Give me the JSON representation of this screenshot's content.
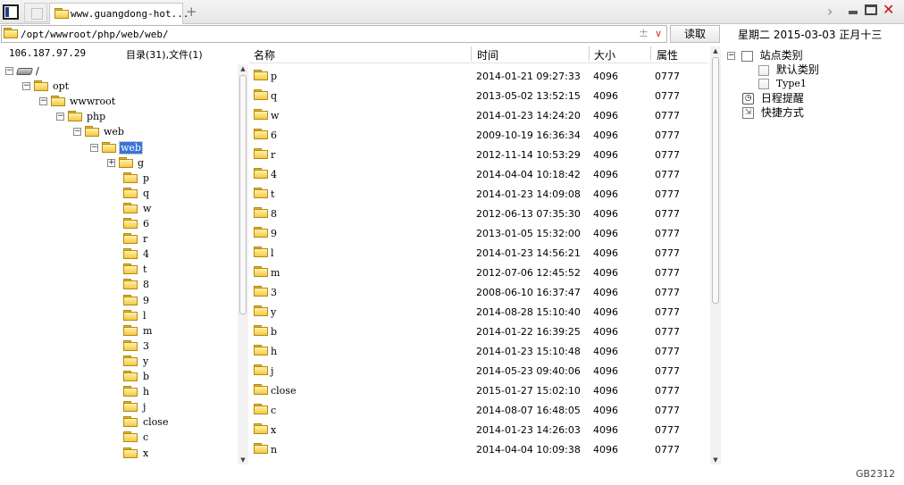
{
  "tabs": {
    "active_title": "www.guangdong-hot...",
    "new_tab_icon": "+"
  },
  "address": {
    "path": "/opt/wwwroot/php/web/web/",
    "plus_glyph": "±",
    "read_button": "读取"
  },
  "date_bar": "星期二  2015-03-03  正月十三",
  "info": {
    "ip": "106.187.97.29",
    "counts": "目录(31),文件(1)"
  },
  "tree": {
    "nodes": [
      {
        "label": "/",
        "icon": "drive-icon",
        "expander": "⊟"
      },
      {
        "label": "opt",
        "icon": "folder-icon",
        "expander": "⊟"
      },
      {
        "label": "wwwroot",
        "icon": "folder-icon",
        "expander": "⊟"
      },
      {
        "label": "php",
        "icon": "folder-icon",
        "expander": "⊟"
      },
      {
        "label": "web",
        "icon": "folder-icon",
        "expander": "⊟"
      },
      {
        "label": "web",
        "icon": "folder-icon",
        "expander": "⊟",
        "selected": true
      },
      {
        "label": "g",
        "icon": "folder-icon",
        "expander": "⊞"
      },
      {
        "label": "p",
        "icon": "folder-icon"
      },
      {
        "label": "q",
        "icon": "folder-icon"
      },
      {
        "label": "w",
        "icon": "folder-icon"
      },
      {
        "label": "6",
        "icon": "folder-icon"
      },
      {
        "label": "r",
        "icon": "folder-icon"
      },
      {
        "label": "4",
        "icon": "folder-icon"
      },
      {
        "label": "t",
        "icon": "folder-icon"
      },
      {
        "label": "8",
        "icon": "folder-icon"
      },
      {
        "label": "9",
        "icon": "folder-icon"
      },
      {
        "label": "l",
        "icon": "folder-icon"
      },
      {
        "label": "m",
        "icon": "folder-icon"
      },
      {
        "label": "3",
        "icon": "folder-icon"
      },
      {
        "label": "y",
        "icon": "folder-icon"
      },
      {
        "label": "b",
        "icon": "folder-icon"
      },
      {
        "label": "h",
        "icon": "folder-icon"
      },
      {
        "label": "j",
        "icon": "folder-icon"
      },
      {
        "label": "close",
        "icon": "folder-icon"
      },
      {
        "label": "c",
        "icon": "folder-icon"
      },
      {
        "label": "x",
        "icon": "folder-icon"
      }
    ]
  },
  "file_list": {
    "columns": [
      "名称",
      "时间",
      "大小",
      "属性"
    ],
    "rows": [
      {
        "name": "p",
        "time": "2014-01-21 09:27:33",
        "size": "4096",
        "attr": "0777"
      },
      {
        "name": "q",
        "time": "2013-05-02 13:52:15",
        "size": "4096",
        "attr": "0777"
      },
      {
        "name": "w",
        "time": "2014-01-23 14:24:20",
        "size": "4096",
        "attr": "0777"
      },
      {
        "name": "6",
        "time": "2009-10-19 16:36:34",
        "size": "4096",
        "attr": "0777"
      },
      {
        "name": "r",
        "time": "2012-11-14 10:53:29",
        "size": "4096",
        "attr": "0777"
      },
      {
        "name": "4",
        "time": "2014-04-04 10:18:42",
        "size": "4096",
        "attr": "0777"
      },
      {
        "name": "t",
        "time": "2014-01-23 14:09:08",
        "size": "4096",
        "attr": "0777"
      },
      {
        "name": "8",
        "time": "2012-06-13 07:35:30",
        "size": "4096",
        "attr": "0777"
      },
      {
        "name": "9",
        "time": "2013-01-05 15:32:00",
        "size": "4096",
        "attr": "0777"
      },
      {
        "name": "l",
        "time": "2014-01-23 14:56:21",
        "size": "4096",
        "attr": "0777"
      },
      {
        "name": "m",
        "time": "2012-07-06 12:45:52",
        "size": "4096",
        "attr": "0777"
      },
      {
        "name": "3",
        "time": "2008-06-10 16:37:47",
        "size": "4096",
        "attr": "0777"
      },
      {
        "name": "y",
        "time": "2014-08-28 15:10:40",
        "size": "4096",
        "attr": "0777"
      },
      {
        "name": "b",
        "time": "2014-01-22 16:39:25",
        "size": "4096",
        "attr": "0777"
      },
      {
        "name": "h",
        "time": "2014-01-23 15:10:48",
        "size": "4096",
        "attr": "0777"
      },
      {
        "name": "j",
        "time": "2014-05-23 09:40:06",
        "size": "4096",
        "attr": "0777"
      },
      {
        "name": "close",
        "time": "2015-01-27 15:02:10",
        "size": "4096",
        "attr": "0777"
      },
      {
        "name": "c",
        "time": "2014-08-07 16:48:05",
        "size": "4096",
        "attr": "0777"
      },
      {
        "name": "x",
        "time": "2014-01-23 14:26:03",
        "size": "4096",
        "attr": "0777"
      },
      {
        "name": "n",
        "time": "2014-04-04 10:09:38",
        "size": "4096",
        "attr": "0777"
      }
    ]
  },
  "right_panel": {
    "site_category": "站点类别",
    "default_category": "默认类别",
    "type1": "Type1",
    "schedule": "日程提醒",
    "shortcuts": "快捷方式"
  },
  "status_code": "GB2312"
}
